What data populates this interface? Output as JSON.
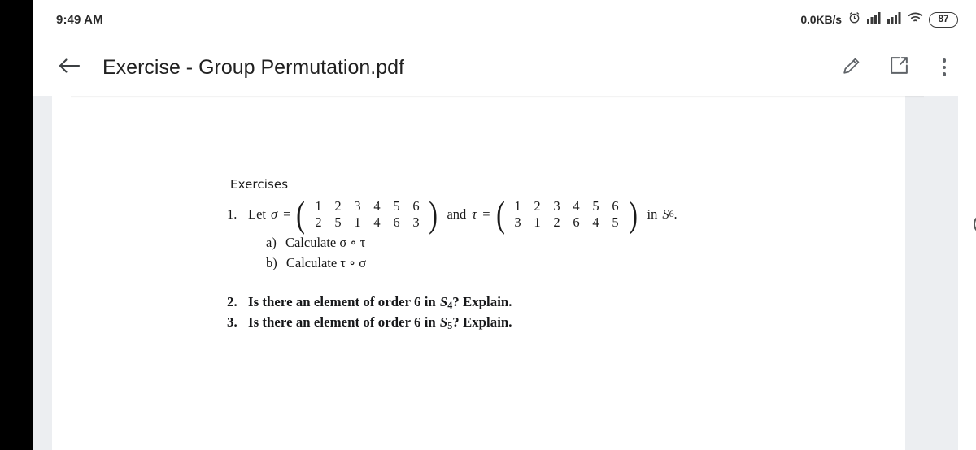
{
  "status_bar": {
    "clock": "9:49 AM",
    "network_speed": "0.0KB/s",
    "battery_percent": "87",
    "icons": [
      "alarm-clock-icon",
      "signal-bars-icon",
      "signal-bars-icon",
      "wifi-icon",
      "battery-icon"
    ]
  },
  "app_bar": {
    "back_label": "back-arrow-icon",
    "title": "Exercise - Group Permutation.pdf",
    "actions": [
      {
        "name": "edit-pencil-icon",
        "label": "Edit"
      },
      {
        "name": "open-external-icon",
        "label": "Open"
      },
      {
        "name": "overflow-menu-icon",
        "label": "More options"
      }
    ]
  },
  "document": {
    "heading": "Exercises",
    "q1": {
      "number": "1.",
      "lead": "Let",
      "sigma_symbol": "σ",
      "equals": "=",
      "sigma_matrix": {
        "top": [
          "1",
          "2",
          "3",
          "4",
          "5",
          "6"
        ],
        "bottom": [
          "2",
          "5",
          "1",
          "4",
          "6",
          "3"
        ]
      },
      "conjunction": "and",
      "tau_symbol": "τ",
      "tau_matrix": {
        "top": [
          "1",
          "2",
          "3",
          "4",
          "5",
          "6"
        ],
        "bottom": [
          "3",
          "1",
          "2",
          "6",
          "4",
          "5"
        ]
      },
      "suffix_in": "in",
      "group_symbol": "S",
      "group_index": "6",
      "suffix_period": ".",
      "parts": [
        {
          "label": "a)",
          "text": "Calculate σ ∘ τ"
        },
        {
          "label": "b)",
          "text": "Calculate τ ∘ σ"
        }
      ]
    },
    "q2": {
      "number": "2.",
      "text_before": "Is there an element of order 6 in",
      "group_symbol": "S",
      "group_index": "4",
      "text_after": "? Explain."
    },
    "q3": {
      "number": "3.",
      "text_before": "Is there an element of order 6 in",
      "group_symbol": "S",
      "group_index": "5",
      "text_after": "? Explain."
    }
  },
  "nav_bar": {
    "back": "back-triangle-icon",
    "home": "home-circle-icon",
    "recents": "recents-square-icon"
  },
  "colors": {
    "bar_background": "#ffffff",
    "viewer_background": "#eceef1",
    "page_background": "#ffffff",
    "icon_gray": "#5f6368",
    "nav_icon_gray": "#565656",
    "text_primary": "#212121"
  }
}
